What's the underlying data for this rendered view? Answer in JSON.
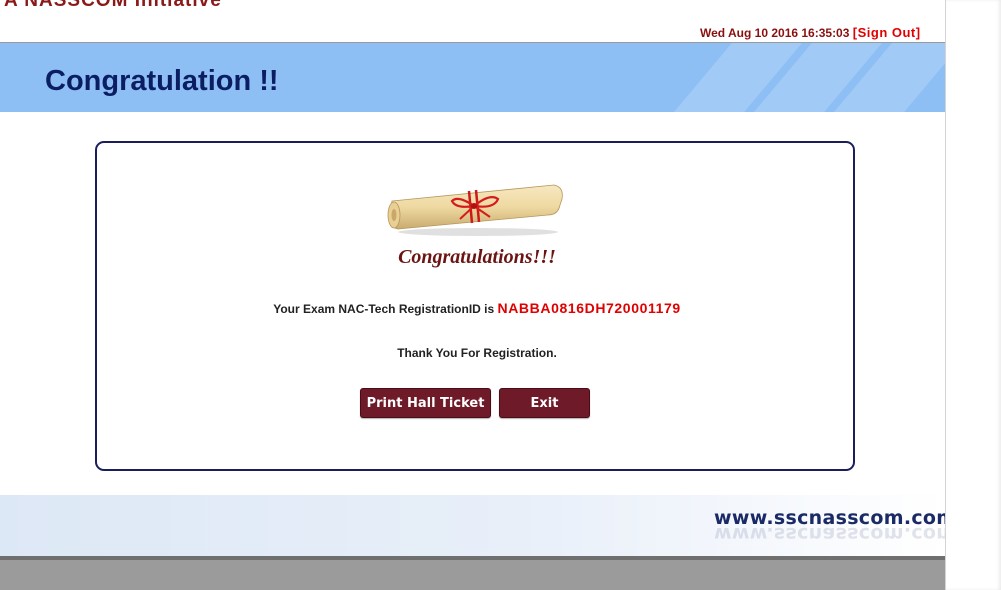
{
  "header": {
    "logo_text": "A NASSCOM Initiative",
    "datetime": "Wed Aug 10 2016 16:35:03",
    "signout_label": "[Sign Out]"
  },
  "banner": {
    "title": "Congratulation !!"
  },
  "card": {
    "image_icon": "diploma-scroll-icon",
    "heading": "Congratulations!!!",
    "registration_prefix": "Your Exam NAC-Tech RegistrationID is",
    "registration_id": "NABBA0816DH720001179",
    "thanks": "Thank You For Registration.",
    "print_button": "Print Hall Ticket",
    "exit_button": "Exit"
  },
  "footer": {
    "website": "www.sscnasscom.com"
  },
  "colors": {
    "banner": "#8ebff4",
    "title": "#0b1e63",
    "button": "#6e1a28",
    "accent_red": "#e00000"
  }
}
